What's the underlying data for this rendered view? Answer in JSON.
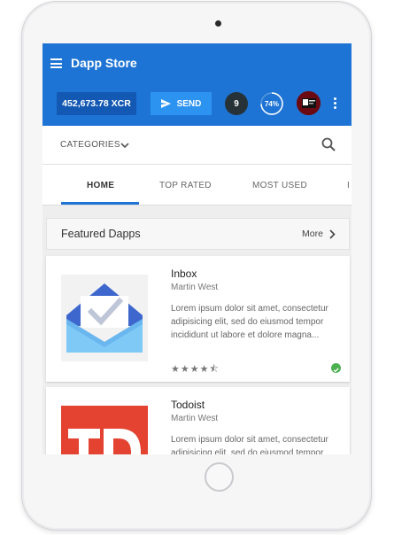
{
  "app": {
    "title": "Dapp Store"
  },
  "toolbar": {
    "balance": "452,673.78 XCR",
    "send_label": "SEND",
    "notification_count": "9",
    "progress_label": "74%",
    "progress_value": 0.74
  },
  "categories": {
    "label": "CATEGORIES"
  },
  "tabs": [
    {
      "label": "HOME",
      "active": true
    },
    {
      "label": "TOP RATED",
      "active": false
    },
    {
      "label": "MOST USED",
      "active": false
    },
    {
      "label": "I",
      "active": false
    }
  ],
  "featured": {
    "title": "Featured Dapps",
    "more_label": "More"
  },
  "apps": [
    {
      "name": "Inbox",
      "author": "Martin West",
      "description": "Lorem ipsum dolor sit amet, consectetur adipisicing elit, sed do eiusmod tempor incididunt ut labore et dolore magna...",
      "rating": 4.5,
      "verified": true,
      "stars": "★★★★⯪"
    },
    {
      "name": "Todoist",
      "author": "Martin West",
      "description": "Lorem ipsum dolor sit amet, consectetur adipisicing elit, sed do eiusmod tempor"
    }
  ],
  "colors": {
    "app_bar": "#1e74d4",
    "balance_bg": "#1359b3",
    "send_bg": "#2d93f1",
    "accent": "#1e74d4",
    "verified": "#4caf50",
    "todoist_red": "#e44332"
  },
  "icons": [
    "menu-icon",
    "send-icon",
    "chevron-down-icon",
    "search-icon",
    "chevron-right-icon",
    "more-vert-icon",
    "check-icon",
    "inbox-app-icon",
    "todoist-app-icon"
  ]
}
